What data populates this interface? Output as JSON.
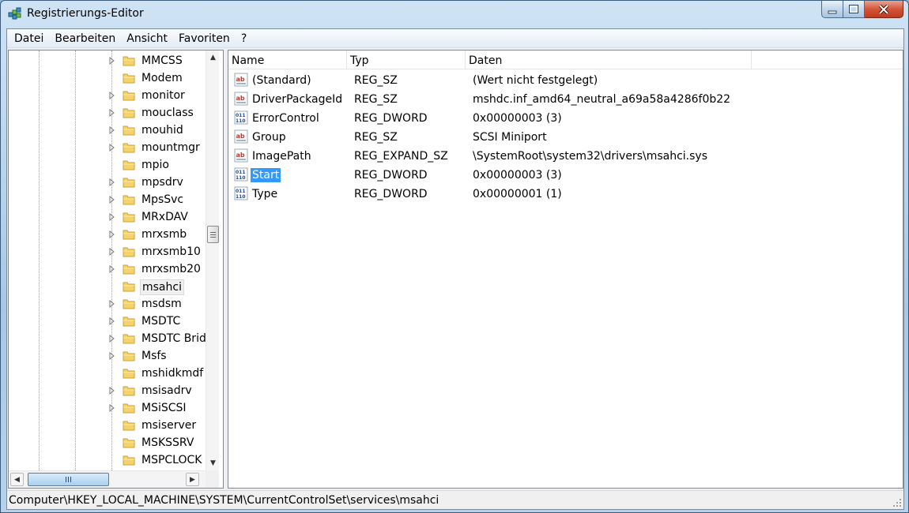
{
  "window": {
    "title": "Registrierungs-Editor"
  },
  "menu": [
    "Datei",
    "Bearbeiten",
    "Ansicht",
    "Favoriten",
    "?"
  ],
  "tree": {
    "items": [
      {
        "label": "MMCSS",
        "expandable": true
      },
      {
        "label": "Modem",
        "expandable": false
      },
      {
        "label": "monitor",
        "expandable": true
      },
      {
        "label": "mouclass",
        "expandable": true
      },
      {
        "label": "mouhid",
        "expandable": true
      },
      {
        "label": "mountmgr",
        "expandable": true
      },
      {
        "label": "mpio",
        "expandable": false
      },
      {
        "label": "mpsdrv",
        "expandable": true
      },
      {
        "label": "MpsSvc",
        "expandable": true
      },
      {
        "label": "MRxDAV",
        "expandable": true
      },
      {
        "label": "mrxsmb",
        "expandable": true
      },
      {
        "label": "mrxsmb10",
        "expandable": true
      },
      {
        "label": "mrxsmb20",
        "expandable": true
      },
      {
        "label": "msahci",
        "expandable": false,
        "selected": true
      },
      {
        "label": "msdsm",
        "expandable": true
      },
      {
        "label": "MSDTC",
        "expandable": true
      },
      {
        "label": "MSDTC Brid",
        "expandable": true
      },
      {
        "label": "Msfs",
        "expandable": true
      },
      {
        "label": "mshidkmdf",
        "expandable": false
      },
      {
        "label": "msisadrv",
        "expandable": true
      },
      {
        "label": "MSiSCSI",
        "expandable": true
      },
      {
        "label": "msiserver",
        "expandable": false
      },
      {
        "label": "MSKSSRV",
        "expandable": false
      },
      {
        "label": "MSPCLOCK",
        "expandable": false
      }
    ]
  },
  "list": {
    "columns": [
      "Name",
      "Typ",
      "Daten"
    ],
    "rows": [
      {
        "icon": "string-value-icon",
        "name": "(Standard)",
        "type": "REG_SZ",
        "data": "(Wert nicht festgelegt)"
      },
      {
        "icon": "string-value-icon",
        "name": "DriverPackageId",
        "type": "REG_SZ",
        "data": "mshdc.inf_amd64_neutral_a69a58a4286f0b22"
      },
      {
        "icon": "binary-value-icon",
        "name": "ErrorControl",
        "type": "REG_DWORD",
        "data": "0x00000003 (3)"
      },
      {
        "icon": "string-value-icon",
        "name": "Group",
        "type": "REG_SZ",
        "data": "SCSI Miniport"
      },
      {
        "icon": "string-value-icon",
        "name": "ImagePath",
        "type": "REG_EXPAND_SZ",
        "data": "\\SystemRoot\\system32\\drivers\\msahci.sys"
      },
      {
        "icon": "binary-value-icon",
        "name": "Start",
        "type": "REG_DWORD",
        "data": "0x00000003 (3)",
        "selected": true
      },
      {
        "icon": "binary-value-icon",
        "name": "Type",
        "type": "REG_DWORD",
        "data": "0x00000001 (1)"
      }
    ]
  },
  "status": {
    "path": "Computer\\HKEY_LOCAL_MACHINE\\SYSTEM\\CurrentControlSet\\services\\msahci"
  },
  "colors": {
    "selection": "#3399ff",
    "folder": "#f5d36b",
    "titlebar": "#a9c7e4"
  }
}
